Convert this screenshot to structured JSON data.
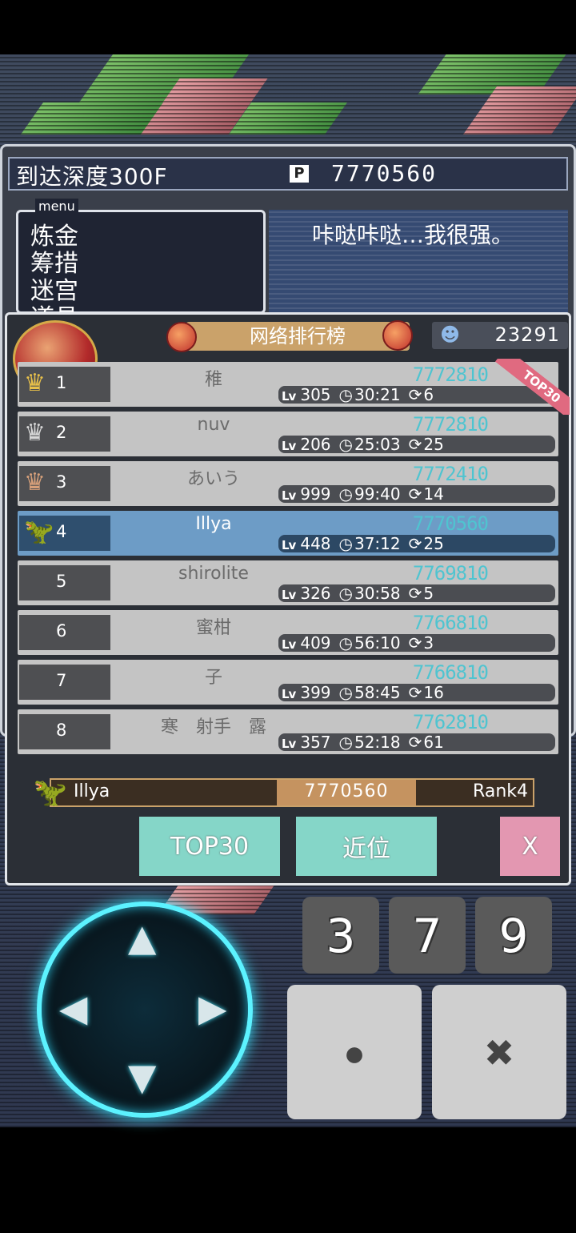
{
  "status": {
    "depth_text": "到达深度300F",
    "points_icon": "P",
    "points_value": "7770560",
    "menu_legend": "menu",
    "menu_items": [
      "炼金",
      "筹措",
      "迷宫",
      "道具"
    ],
    "speech": "咔哒咔哒…我很强。"
  },
  "ranking": {
    "title": "网络排行榜",
    "players_icon": "players-icon",
    "players_count": "23291",
    "top30_badge": "TOP30",
    "lv_label": "Lv",
    "rows": [
      {
        "rank": "1",
        "name": "稚",
        "score": "7772810",
        "lv": "305",
        "time": "30:21",
        "loops": "6",
        "crown": "gold-crown-icon"
      },
      {
        "rank": "2",
        "name": "nuv",
        "score": "7772810",
        "lv": "206",
        "time": "25:03",
        "loops": "25",
        "crown": "silver-crown-icon"
      },
      {
        "rank": "3",
        "name": "あいう",
        "score": "7772410",
        "lv": "999",
        "time": "99:40",
        "loops": "14",
        "crown": "bronze-crown-icon"
      },
      {
        "rank": "4",
        "name": "Illya",
        "score": "7770560",
        "lv": "448",
        "time": "37:12",
        "loops": "25",
        "crown": "dino-avatar-icon",
        "me": true
      },
      {
        "rank": "5",
        "name": "shirolite",
        "score": "7769810",
        "lv": "326",
        "time": "30:58",
        "loops": "5"
      },
      {
        "rank": "6",
        "name": "蜜柑",
        "score": "7766810",
        "lv": "409",
        "time": "56:10",
        "loops": "3"
      },
      {
        "rank": "7",
        "name": "子",
        "score": "7766810",
        "lv": "399",
        "time": "58:45",
        "loops": "16"
      },
      {
        "rank": "8",
        "name": "寒　射手　露",
        "score": "7762810",
        "lv": "357",
        "time": "52:18",
        "loops": "61"
      }
    ],
    "me": {
      "name": "Illya",
      "score": "7770560",
      "rank": "Rank4"
    },
    "buttons": {
      "top30": "TOP30",
      "near": "近位",
      "close": "X"
    }
  },
  "controls": {
    "dpad": {
      "up": "▲",
      "down": "▼",
      "left": "◀",
      "right": "▶"
    },
    "number_buttons": [
      "3",
      "7",
      "9"
    ],
    "confirm": "●",
    "cancel": "✖"
  },
  "colors": {
    "accent": "#85d6c8",
    "score": "#4fc4d0",
    "highlight_row": "#6d9cc6",
    "close": "#e397b1"
  }
}
